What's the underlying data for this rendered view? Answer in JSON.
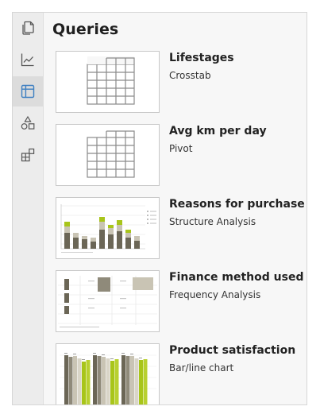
{
  "panel": {
    "title": "Queries"
  },
  "rail": {
    "buttons": [
      {
        "icon": "pages-icon",
        "active": false
      },
      {
        "icon": "line-chart-icon",
        "active": false
      },
      {
        "icon": "table-icon",
        "active": true
      },
      {
        "icon": "shapes-icon",
        "active": false
      },
      {
        "icon": "widgets-icon",
        "active": false
      }
    ]
  },
  "queries": [
    {
      "name": "Lifestages",
      "type": "Crosstab",
      "thumbnail": "grid-icon"
    },
    {
      "name": "Avg km per day",
      "type": "Pivot",
      "thumbnail": "grid-icon"
    },
    {
      "name": "Reasons for purchase",
      "type": "Structure Analysis",
      "thumbnail": "stacked-bar-preview"
    },
    {
      "name": "Finance method used",
      "type": "Frequency Analysis",
      "thumbnail": "frequency-table-preview"
    },
    {
      "name": "Product satisfaction",
      "type": "Bar/line chart",
      "thumbnail": "bar-chart-preview"
    }
  ],
  "colors": {
    "accent": "#3d7fc1",
    "panel_bg": "#f7f7f7",
    "rail_bg": "#ececec",
    "bar_dark": "#6b6656",
    "bar_light": "#c9c4b4",
    "bar_green": "#a8c51a"
  }
}
